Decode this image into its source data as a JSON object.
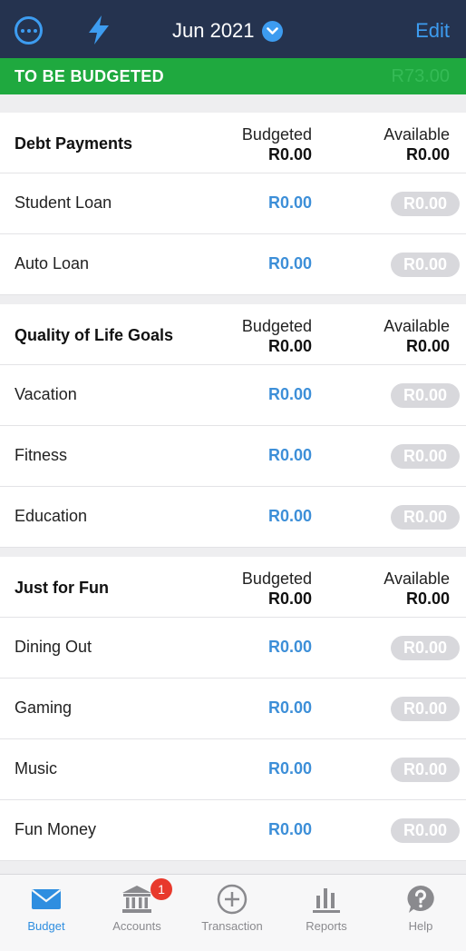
{
  "header": {
    "month": "Jun 2021",
    "edit_label": "Edit"
  },
  "to_be_budgeted": {
    "label": "TO BE BUDGETED",
    "amount": "R73.00"
  },
  "groups": [
    {
      "title": "Debt Payments",
      "budgeted_label": "Budgeted",
      "budgeted_total": "R0.00",
      "available_label": "Available",
      "available_total": "R0.00",
      "rows": [
        {
          "name": "Student Loan",
          "budgeted": "R0.00",
          "available": "R0.00"
        },
        {
          "name": "Auto Loan",
          "budgeted": "R0.00",
          "available": "R0.00"
        }
      ]
    },
    {
      "title": "Quality of Life Goals",
      "budgeted_label": "Budgeted",
      "budgeted_total": "R0.00",
      "available_label": "Available",
      "available_total": "R0.00",
      "rows": [
        {
          "name": "Vacation",
          "budgeted": "R0.00",
          "available": "R0.00"
        },
        {
          "name": "Fitness",
          "budgeted": "R0.00",
          "available": "R0.00"
        },
        {
          "name": "Education",
          "budgeted": "R0.00",
          "available": "R0.00"
        }
      ]
    },
    {
      "title": "Just for Fun",
      "budgeted_label": "Budgeted",
      "budgeted_total": "R0.00",
      "available_label": "Available",
      "available_total": "R0.00",
      "rows": [
        {
          "name": "Dining Out",
          "budgeted": "R0.00",
          "available": "R0.00"
        },
        {
          "name": "Gaming",
          "budgeted": "R0.00",
          "available": "R0.00"
        },
        {
          "name": "Music",
          "budgeted": "R0.00",
          "available": "R0.00"
        },
        {
          "name": "Fun Money",
          "budgeted": "R0.00",
          "available": "R0.00"
        }
      ]
    }
  ],
  "tabbar": {
    "tabs": [
      {
        "label": "Budget",
        "icon": "envelope-icon",
        "active": true
      },
      {
        "label": "Accounts",
        "icon": "bank-icon",
        "active": false
      },
      {
        "label": "Transaction",
        "icon": "plus-circle-icon",
        "active": false
      },
      {
        "label": "Reports",
        "icon": "bar-chart-icon",
        "active": false
      },
      {
        "label": "Help",
        "icon": "help-bubble-icon",
        "active": false
      }
    ],
    "accounts_badge": "1"
  },
  "colors": {
    "header_bg": "#25334f",
    "accent_blue": "#3d9cf0",
    "to_be_budgeted_green": "#1fa93f",
    "badge_red": "#e8392c",
    "pill_grey": "#d8d8dc"
  }
}
